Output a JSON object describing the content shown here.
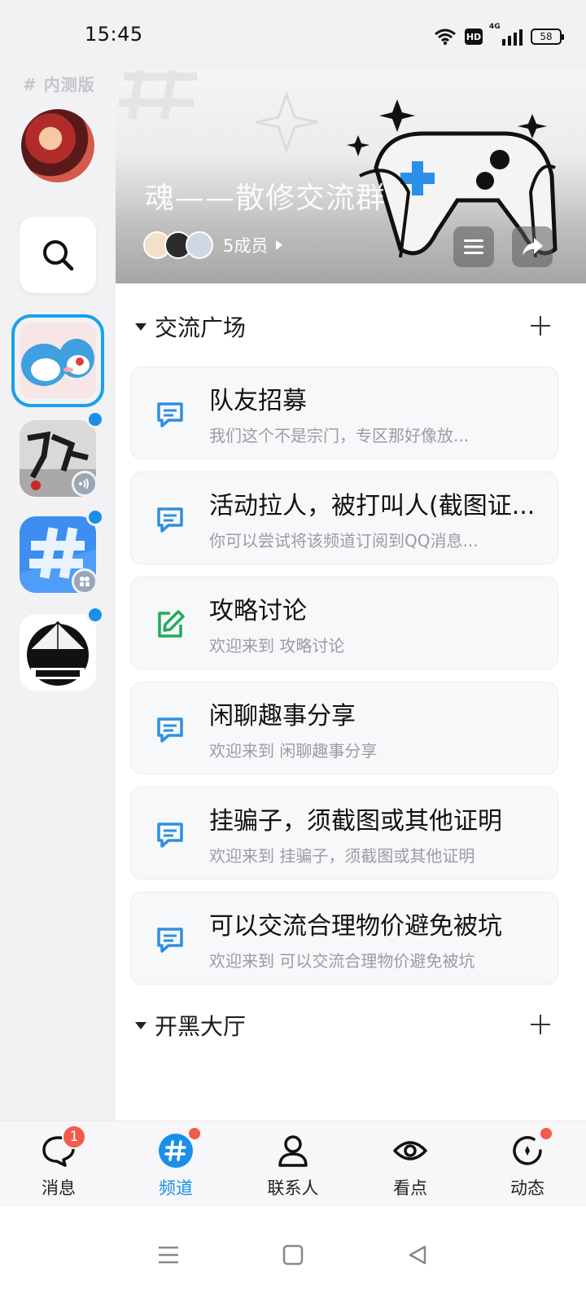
{
  "status_bar": {
    "time": "15:45",
    "hd": "HD",
    "network": "4G",
    "battery": "58"
  },
  "rail": {
    "beta_label": "# 内测版",
    "icons": [
      "search-icon"
    ],
    "accent": "#1aa0ec"
  },
  "banner": {
    "title": "魂——散修交流群",
    "member_count": "5成员"
  },
  "sections": [
    {
      "label": "交流广场"
    },
    {
      "label": "开黑大厅"
    }
  ],
  "channels": [
    {
      "name": "队友招募",
      "desc": "我们这个不是宗门，专区那好像放...",
      "icon": "chat-icon"
    },
    {
      "name": "活动拉人，被打叫人(截图证...",
      "desc": "你可以尝试将该频道订阅到QQ消息...",
      "icon": "chat-icon"
    },
    {
      "name": "攻略讨论",
      "desc": "欢迎来到 攻略讨论",
      "icon": "edit-icon"
    },
    {
      "name": "闲聊趣事分享",
      "desc": "欢迎来到 闲聊趣事分享",
      "icon": "chat-icon"
    },
    {
      "name": "挂骗子，须截图或其他证明",
      "desc": "欢迎来到 挂骗子，须截图或其他证明",
      "icon": "chat-icon"
    },
    {
      "name": "可以交流合理物价避免被坑",
      "desc": "欢迎来到 可以交流合理物价避免被坑",
      "icon": "chat-icon"
    }
  ],
  "tabbar": {
    "tabs": [
      {
        "label": "消息",
        "badge": "1"
      },
      {
        "label": "频道"
      },
      {
        "label": "联系人"
      },
      {
        "label": "看点"
      },
      {
        "label": "动态"
      }
    ],
    "active_color": "#1a8fe8",
    "badge_color": "#f25b4b"
  }
}
